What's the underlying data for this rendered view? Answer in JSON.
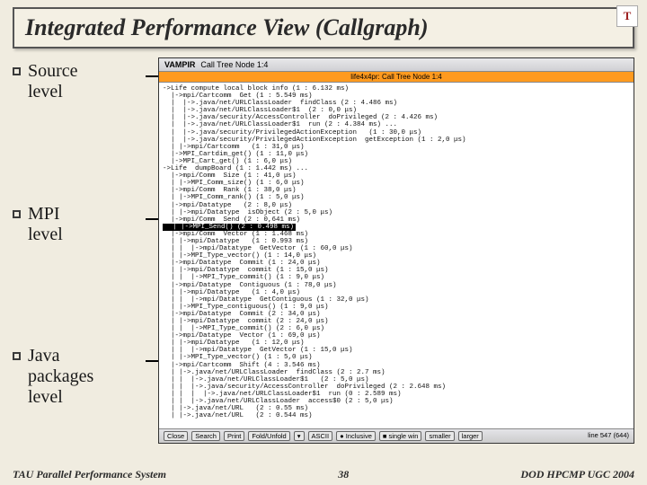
{
  "title": "Integrated Performance View (Callgraph)",
  "corner_badge": "T",
  "bullets": [
    {
      "label": "Source\nlevel"
    },
    {
      "label": "MPI\nlevel"
    },
    {
      "label": "Java\npackages\nlevel"
    }
  ],
  "panel": {
    "window_label": "VAMPIR",
    "window_sub": "Call Tree Node 1:4",
    "subtitle": "life4x4pr: Call Tree Node 1:4",
    "status_buttons": [
      "Close",
      "Search",
      "Print",
      "Fold/Unfold",
      "▾",
      "ASCII",
      "● Inclusive",
      "■ single win",
      "smaller",
      "larger"
    ],
    "status_line": "line 547 (644)"
  },
  "tree_lines": [
    "->Life compute local block info (1 : 6.132 ms)",
    "  |->mpi/Cartcomm  Get (1 : 5.549 ms)",
    "  |  |->.java/net/URLClassLoader  findClass (2 : 4.486 ms)",
    "  |  |->.java/net/URLClassLoader$1  (2 : 0,0 μs)",
    "  |  |->.java/security/AccessController  doPrivileged (2 : 4.426 ms)",
    "  |  |->.java/net/URLClassLoader$1  run (2 : 4.384 ms) ...",
    "  |  |->.java/security/PrivilegedActionException  <init> (1 : 30,0 μs)",
    "  |  |->.java/security/PrivilegedActionException  getException (1 : 2,0 μs)",
    "  | |->mpi/Cartcomm  <init> (1 : 31,0 μs)",
    "  |->MPI_Cartdim_get() (1 : 11,0 μs)",
    "  |->MPI_Cart_get() (1 : 6,0 μs)",
    "->Life  dumpBoard (1 : 1.442 ms) ...",
    "  |->mpi/Comm  Size (1 : 41,0 μs)",
    "  | |->MPI_Comm_size() (1 : 6,0 μs)",
    "  |->mpi/Comm  Rank (1 : 38,0 μs)",
    "  | |->MPI_Comm_rank() (1 : 5,0 μs)",
    "  |->mpi/Datatype  <init> (2 : 8,0 μs)",
    "  | |->mpi/Datatype  isObject (2 : 5,0 μs)",
    "  |->mpi/Comm  Send (2 : 0,641 ms)"
  ],
  "tree_highlight": "  | |->MPI_Send() (2 : 0.498 ms)",
  "tree_lines_after": [
    "  |->mpi/Comm  Vector (1 : 1.468 ms)",
    "  | |->mpi/Datatype  <init> (1 : 0.993 ms)",
    "  | |  |->mpi/Datatype  GetVector (1 : 60,0 μs)",
    "  | |->MPI_Type_vector() (1 : 14,0 μs)",
    "  |->mpi/Datatype  Commit (1 : 24,0 μs)",
    "  | |->mpi/Datatype  commit (1 : 15,0 μs)",
    "  | |  |->MPI_Type_commit() (1 : 9,0 μs)",
    "  |->mpi/Datatype  Contiguous (1 : 78,0 μs)",
    "  | |->mpi/Datatype  <init> (1 : 4,0 μs)",
    "  | |  |->mpi/Datatype  GetContiguous (1 : 32,0 μs)",
    "  | |->MPI_Type_contiguous() (1 : 9,0 μs)",
    "  |->mpi/Datatype  Commit (2 : 34,0 μs)",
    "  | |->mpi/Datatype  commit (2 : 24,0 μs)",
    "  | |  |->MPI_Type_commit() (2 : 6,0 μs)",
    "  |->mpi/Datatype  Vector (1 : 69,0 μs)",
    "  | |->mpi/Datatype  <init> (1 : 12,0 μs)",
    "  | |  |->mpi/Datatype  GetVector (1 : 15,0 μs)",
    "  | |->MPI_Type_vector() (1 : 5,0 μs)",
    "  |->mpi/Cartcomm  Shift (4 : 3.546 ms)",
    "  | |->.java/net/URLClassLoader  findClass (2 : 2.7 ms)",
    "  | |  |->.java/net/URLClassLoader$1  <init> (2 : 5,0 μs)",
    "  | |  |->.java/security/AccessController  doPrivileged (2 : 2.648 ms)",
    "  | |  |  |->.java/net/URLClassLoader$1  run (0 : 2.589 ms)",
    "  | |  |->.java/net/URLClassLoader  access$0 (2 : 5,0 μs)",
    "  | |->.java/net/URL  <init> (2 : 0.55 ms)",
    "  | |->.java/net/URL  <init> (2 : 0.544 ms)"
  ],
  "footer": {
    "left": "TAU Parallel Performance System",
    "center": "38",
    "right": "DOD HPCMP UGC 2004"
  }
}
